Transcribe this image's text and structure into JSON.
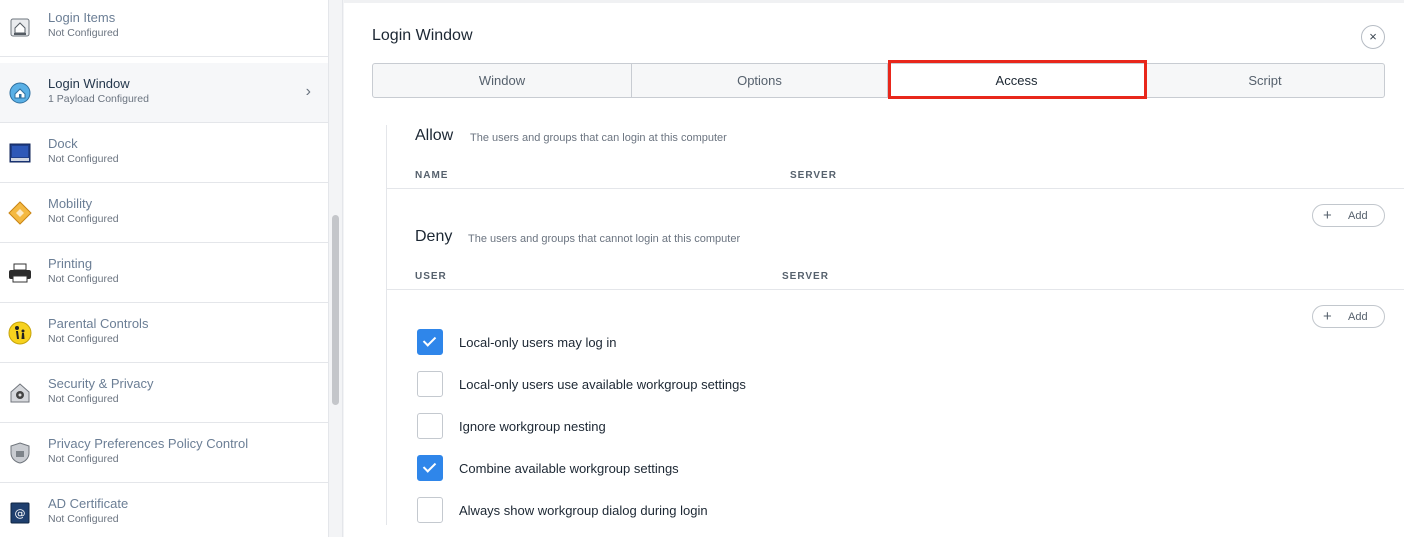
{
  "sidebar": {
    "items": [
      {
        "title": "Login Items",
        "status": "Not Configured",
        "icon": "login-items-icon"
      },
      {
        "title": "Login Window",
        "status": "1 Payload Configured",
        "icon": "login-window-icon"
      },
      {
        "title": "Dock",
        "status": "Not Configured",
        "icon": "dock-icon"
      },
      {
        "title": "Mobility",
        "status": "Not Configured",
        "icon": "mobility-icon"
      },
      {
        "title": "Printing",
        "status": "Not Configured",
        "icon": "printer-icon"
      },
      {
        "title": "Parental Controls",
        "status": "Not Configured",
        "icon": "parental-controls-icon"
      },
      {
        "title": "Security & Privacy",
        "status": "Not Configured",
        "icon": "security-privacy-icon"
      },
      {
        "title": "Privacy Preferences Policy Control",
        "status": "Not Configured",
        "icon": "privacy-shield-icon"
      },
      {
        "title": "AD Certificate",
        "status": "Not Configured",
        "icon": "certificate-icon"
      }
    ],
    "chevron": "›"
  },
  "main": {
    "title": "Login Window",
    "close_glyph": "×",
    "tabs": [
      "Window",
      "Options",
      "Access",
      "Script"
    ],
    "active_tab": "Access",
    "allow": {
      "heading": "Allow",
      "description": "The users and groups that can login at this computer",
      "col1": "NAME",
      "col2": "SERVER",
      "add_label": "Add"
    },
    "deny": {
      "heading": "Deny",
      "description": "The users and groups that cannot login at this computer",
      "col1": "USER",
      "col2": "SERVER",
      "add_label": "Add"
    },
    "plus_glyph": "+",
    "options": [
      {
        "label": "Local-only users may log in",
        "checked": true
      },
      {
        "label": "Local-only users use available workgroup settings",
        "checked": false
      },
      {
        "label": "Ignore workgroup nesting",
        "checked": false
      },
      {
        "label": "Combine available workgroup settings",
        "checked": true
      },
      {
        "label": "Always show workgroup dialog during login",
        "checked": false
      }
    ]
  },
  "colors": {
    "accent": "#2f86ea",
    "highlight": "#e8271b"
  }
}
